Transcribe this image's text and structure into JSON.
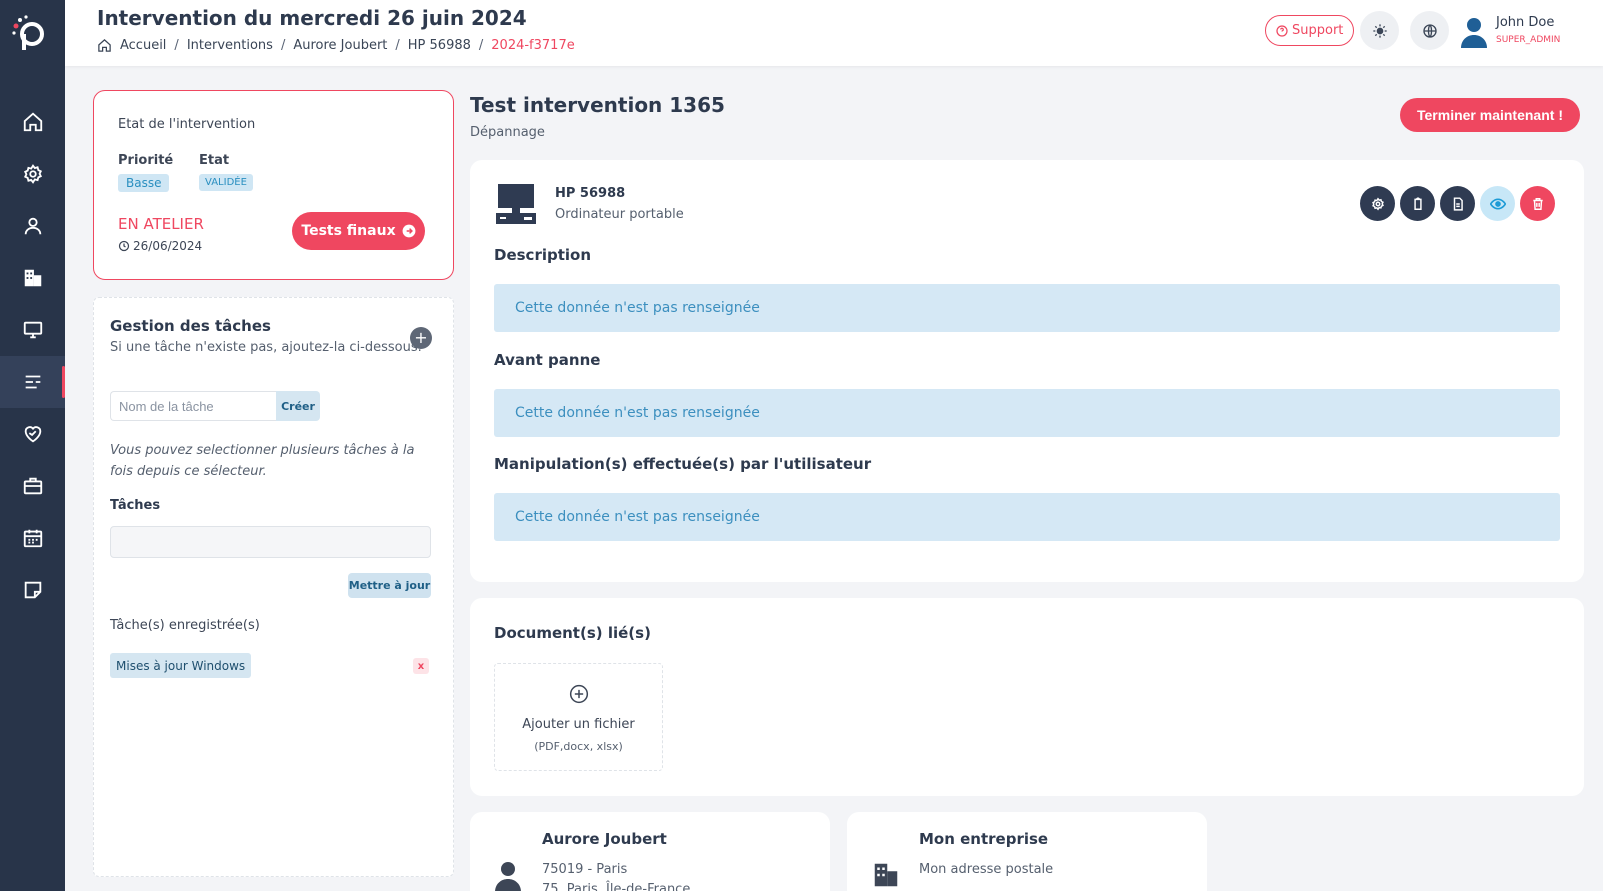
{
  "header": {
    "title": "Intervention du mercredi 26 juin 2024",
    "breadcrumb": [
      "Accueil",
      "Interventions",
      "Aurore Joubert",
      "HP 56988",
      "2024-f3717e"
    ],
    "support_label": "Support",
    "user": {
      "name": "John Doe",
      "role": "SUPER_ADMIN"
    }
  },
  "sidebar": {
    "items": [
      {
        "icon": "home-icon"
      },
      {
        "icon": "gear-icon"
      },
      {
        "icon": "user-icon"
      },
      {
        "icon": "building-icon"
      },
      {
        "icon": "monitor-icon"
      },
      {
        "icon": "task-list-icon",
        "active": true
      },
      {
        "icon": "heart-handshake-icon"
      },
      {
        "icon": "briefcase-icon"
      },
      {
        "icon": "calendar-icon"
      },
      {
        "icon": "note-icon"
      }
    ]
  },
  "state": {
    "title": "Etat de l'intervention",
    "priority_label": "Priorité",
    "priority_value": "Basse",
    "status_label": "Etat",
    "status_value": "VALIDÉE",
    "stage": "EN ATELIER",
    "date": "26/06/2024",
    "tests_button": "Tests finaux"
  },
  "tasks": {
    "title": "Gestion des tâches",
    "subtitle": "Si une tâche n'existe pas, ajoutez-la ci-dessous.",
    "input_placeholder": "Nom de la tâche",
    "create_label": "Créer",
    "help_text": "Vous pouvez selectionner plusieurs tâches à la fois depuis ce sélecteur.",
    "select_label": "Tâches",
    "update_label": "Mettre à jour",
    "saved_label": "Tâche(s) enregistrée(s)",
    "saved": [
      "Mises à jour Windows"
    ],
    "remove_label": "x"
  },
  "intervention": {
    "title": "Test intervention 1365",
    "type": "Dépannage",
    "finish_button": "Terminer maintenant !"
  },
  "device": {
    "name": "HP 56988",
    "type": "Ordinateur portable",
    "sections": [
      {
        "title": "Description",
        "value": "Cette donnée n'est pas renseignée"
      },
      {
        "title": "Avant panne",
        "value": "Cette donnée n'est pas renseignée"
      },
      {
        "title": "Manipulation(s) effectuée(s) par l'utilisateur",
        "value": "Cette donnée n'est pas renseignée"
      }
    ]
  },
  "documents": {
    "title": "Document(s) lié(s)",
    "add_label": "Ajouter un fichier",
    "add_hint": "(PDF,docx, xlsx)"
  },
  "customer": {
    "name": "Aurore Joubert",
    "line1": "75019 - Paris",
    "line2": "75, Paris, Île-de-France"
  },
  "company": {
    "name": "Mon entreprise",
    "line1": "Mon adresse postale"
  },
  "colors": {
    "accent": "#ef4760",
    "sidebar": "#283449",
    "info_bg": "#d5e8f5"
  }
}
